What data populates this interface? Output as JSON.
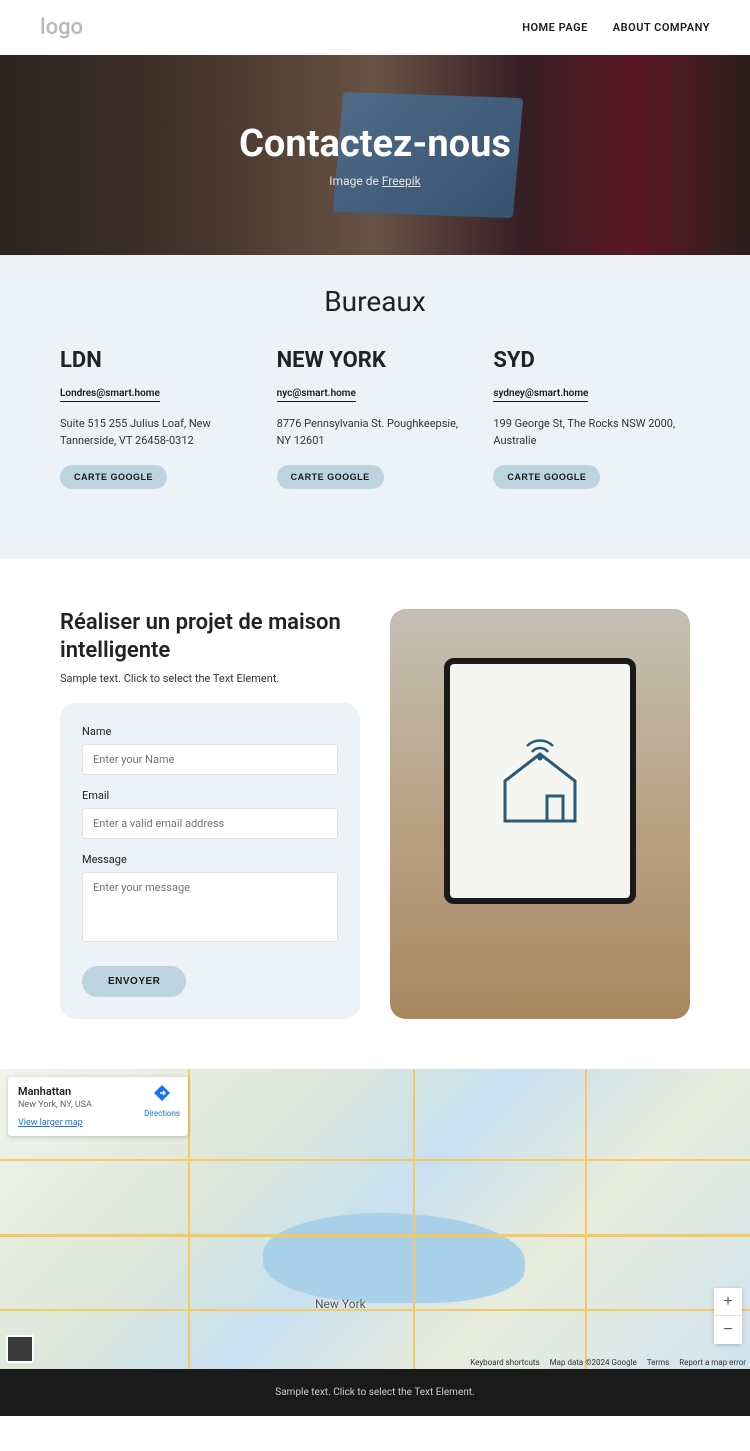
{
  "header": {
    "logo": "logo",
    "nav": {
      "home": "HOME PAGE",
      "about": "ABOUT COMPANY"
    }
  },
  "hero": {
    "title": "Contactez-nous",
    "credit_prefix": "Image de ",
    "credit_link": "Freepik"
  },
  "offices": {
    "title": "Bureaux",
    "map_btn": "CARTE GOOGLE",
    "items": [
      {
        "name": "LDN",
        "email": "Londres@smart.home",
        "address": "Suite 515 255 Julius Loaf, New Tannerside, VT 26458-0312"
      },
      {
        "name": "NEW YORK",
        "email": "nyc@smart.home",
        "address": "8776 Pennsylvania St. Poughkeepsie, NY 12601"
      },
      {
        "name": "SYD",
        "email": "sydney@smart.home",
        "address": "199 George St, The Rocks NSW 2000, Australie"
      }
    ]
  },
  "form": {
    "title": "Réaliser un projet de maison intelligente",
    "subtitle": "Sample text. Click to select the Text Element.",
    "name_label": "Name",
    "name_ph": "Enter your Name",
    "email_label": "Email",
    "email_ph": "Enter a valid email address",
    "msg_label": "Message",
    "msg_ph": "Enter your message",
    "submit": "ENVOYER"
  },
  "map": {
    "card_title": "Manhattan",
    "card_sub": "New York, NY, USA",
    "card_link": "View larger map",
    "directions": "Directions",
    "city_label": "New York",
    "zoom_in": "+",
    "zoom_out": "−",
    "attrib_shortcuts": "Keyboard shortcuts",
    "attrib_data": "Map data ©2024 Google",
    "attrib_terms": "Terms",
    "attrib_report": "Report a map error"
  },
  "footer": {
    "text": "Sample text. Click to select the Text Element."
  }
}
